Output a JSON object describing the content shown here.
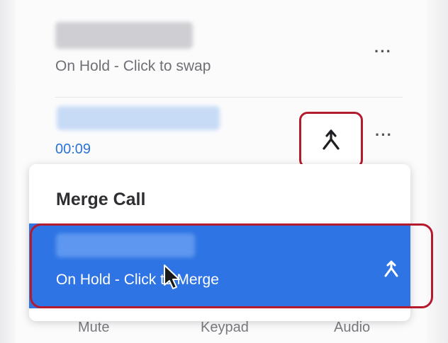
{
  "call_list": {
    "held_call": {
      "status": "On Hold - Click to swap",
      "more_label": "···"
    },
    "active_call": {
      "timer": "00:09",
      "more_label": "···"
    }
  },
  "merge_popup": {
    "title": "Merge Call",
    "held_item": {
      "status": "On Hold - Click to Merge"
    }
  },
  "controls": {
    "mute": "Mute",
    "keypad": "Keypad",
    "audio": "Audio"
  },
  "colors": {
    "accent": "#2f74e4",
    "timer": "#2a73d9",
    "highlight": "#b31b2e"
  },
  "icons": [
    "merge-icon",
    "more-icon",
    "cursor-icon"
  ]
}
